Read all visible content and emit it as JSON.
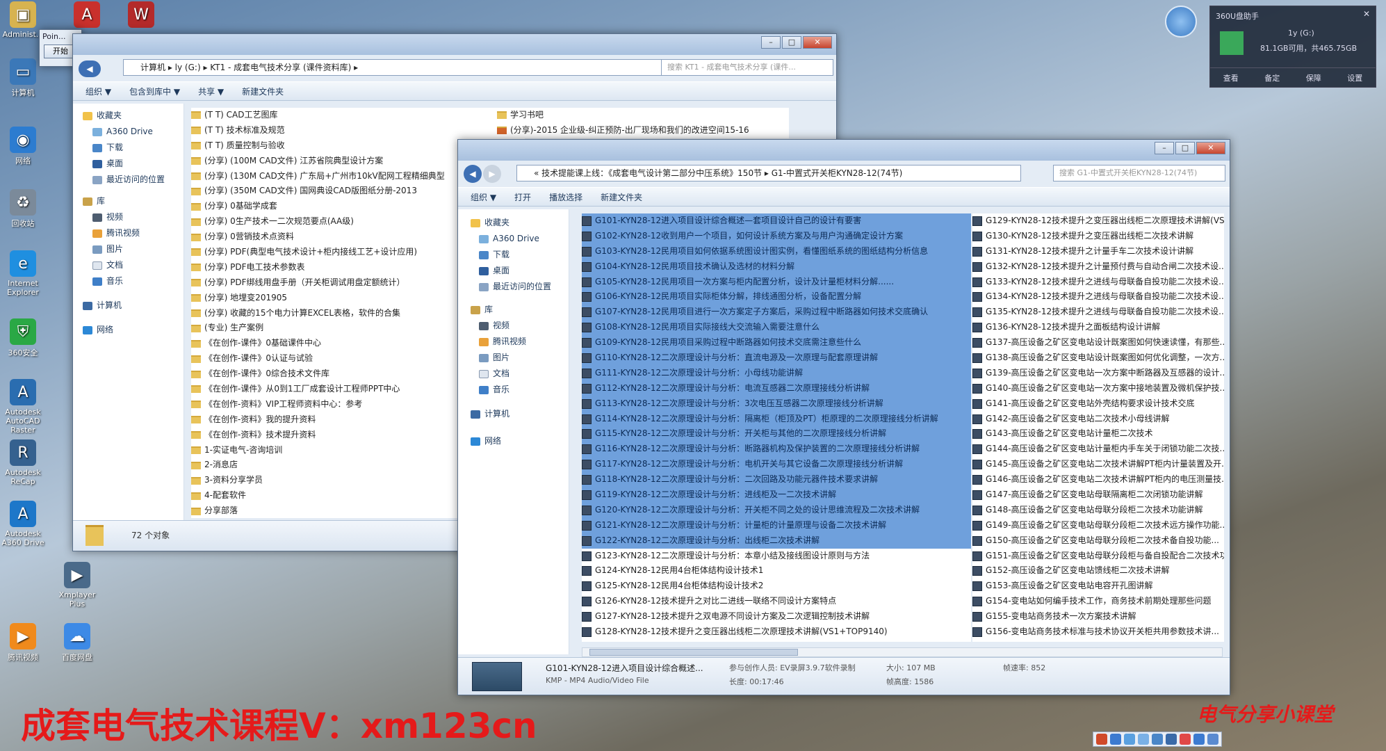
{
  "desktop": {
    "icons": [
      "Administ...",
      "计算机",
      "网络",
      "回收站",
      "Internet Explorer",
      "360安全",
      "Autodesk AutoCAD Raster",
      "Autodesk ReCap",
      "Autodesk A360 Drive",
      "Xmplayer Plus",
      "腾讯视频",
      "百度网盘"
    ]
  },
  "overlay": {
    "watermark": "成套电气技术课程V：xm123cn",
    "brand": "电气分享小课堂"
  },
  "mini_window": {
    "title": "Poin...",
    "button": "开始"
  },
  "left_window": {
    "address": [
      "计算机",
      "ly (G:)",
      "KT1 - 成套电气技术分享 (课件资料库)"
    ],
    "search_placeholder": "搜索 KT1 - 成套电气技术分享 (课件...",
    "toolbar": [
      "组织 ▼",
      "包含到库中 ▼",
      "共享 ▼",
      "新建文件夹"
    ],
    "nav": [
      "收藏夹",
      "A360 Drive",
      "下载",
      "桌面",
      "最近访问的位置",
      "库",
      "视频",
      "腾讯视频",
      "图片",
      "文档",
      "音乐",
      "计算机",
      "网络"
    ],
    "files": [
      "(T T) CAD工艺图库",
      "(T T) 技术标准及规范",
      "(T T) 质量控制与验收",
      "(分享) (100M CAD文件) 江苏省院典型设计方案",
      "(分享) (130M CAD文件) 广东局+广州市10kV配网工程精细典型",
      "(分享) (350M CAD文件) 国网典设CAD版图纸分册-2013",
      "(分享) 0基础学成套",
      "(分享) 0生产技术一二次规范要点(AA级)",
      "(分享) 0营销技术点资料",
      "(分享) PDF(典型电气技术设计+柜内接线工艺+设计应用)",
      "(分享) PDF电工技术参数表",
      "(分享) PDF绑线用盘手册（开关柜调试用盘定额统计）",
      "(分享) 地埋变201905",
      "(分享) 收藏的15个电力计算EXCEL表格，软件的合集",
      "(专业) 生产案例",
      "《在创作-课件》0基础课件中心",
      "《在创作-课件》0认证与试验",
      "《在创作-课件》0综合技术文件库",
      "《在创作-课件》从0到1工厂成套设计工程师PPT中心",
      "《在创作-资料》VIP工程师资料中心：参考",
      "《在创作-资料》我的提升资料",
      "《在创作-资料》技术提升资料",
      "1-实证电气-咨询培训",
      "2-消息店",
      "3-资料分享学员",
      "4-配套软件",
      "分享部落"
    ],
    "files_right": [
      "学习书吧",
      "(分享)-2015 企业级-纠正预防-出厂现场和我们的改进空间15-16"
    ],
    "status": "72 个对象"
  },
  "right_window": {
    "address": [
      "«",
      "技术提能课上线：《成套电气设计第二部分中压系统》150节",
      "G1-中置式开关柜KYN28-12(74节)"
    ],
    "search_placeholder": "搜索 G1-中置式开关柜KYN28-12(74节)",
    "toolbar": [
      "组织 ▼",
      "打开",
      "播放选择",
      "新建文件夹"
    ],
    "nav": [
      "收藏夹",
      "A360 Drive",
      "下载",
      "桌面",
      "最近访问的位置",
      "库",
      "视频",
      "腾讯视频",
      "图片",
      "文档",
      "音乐",
      "计算机",
      "网络"
    ],
    "files_col1": [
      "G101-KYN28-12进入项目设计综合概述—套项目设计自己的设计有要害",
      "G102-KYN28-12收到用户一个项目，如何设计系统方案及与用户沟通确定设计方案",
      "G103-KYN28-12民用项目如何依据系统图设计图实例，看懂图纸系统的图纸结构分析信息",
      "G104-KYN28-12民用项目技术确认及选材的材料分解",
      "G105-KYN28-12民用项目一次方案与柜内配置分析，设计及计量柜材料分解......",
      "G106-KYN28-12民用项目实际柜体分解，排线通图分析，设备配置分解",
      "G107-KYN28-12民用项目进行一次方案定子方案后，采购过程中断路器如何技术交底确认",
      "G108-KYN28-12民用项目实际接线大交流输入需要注意什么",
      "G109-KYN28-12民用项目采购过程中断路器如何技术交底需注意些什么",
      "G110-KYN28-12二次原理设计与分析：直流电源及一次原理与配套原理讲解",
      "G111-KYN28-12二次原理设计与分析：小母线功能讲解",
      "G112-KYN28-12二次原理设计与分析：电流互感器二次原理接线分析讲解",
      "G113-KYN28-12二次原理设计与分析：3次电压互感器二次原理接线分析讲解",
      "G114-KYN28-12二次原理设计与分析：隔离柜（柜顶及PT）柜原理的二次原理接线分析讲解",
      "G115-KYN28-12二次原理设计与分析：开关柜与其他的二次原理接线分析讲解",
      "G116-KYN28-12二次原理设计与分析：断路器机构及保护装置的二次原理接线分析讲解",
      "G117-KYN28-12二次原理设计与分析：电机开关与其它设备二次原理接线分析讲解",
      "G118-KYN28-12二次原理设计与分析：二次回路及功能元器件技术要求讲解",
      "G119-KYN28-12二次原理设计与分析：进线柜及一二次技术讲解",
      "G120-KYN28-12二次原理设计与分析：开关柜不同之处的设计思维流程及二次技术讲解",
      "G121-KYN28-12二次原理设计与分析：计量柜的计量原理与设备二次技术讲解",
      "G122-KYN28-12二次原理设计与分析：出线柜二次技术讲解",
      "G123-KYN28-12二次原理设计与分析：本章小结及接线图设计原则与方法",
      "G124-KYN28-12民用4台柜体结构设计技术1",
      "G125-KYN28-12民用4台柜体结构设计技术2",
      "G126-KYN28-12技术提升之对比二进线一联络不同设计方案特点",
      "G127-KYN28-12技术提升之双电源不同设计方案及二次逻辑控制技术讲解",
      "G128-KYN28-12技术提升之变压器出线柜二次原理技术讲解(VS1+TOP9140)"
    ],
    "files_col2": [
      "G129-KYN28-12技术提升之变压器出线柜二次原理技术讲解(VS1...",
      "G130-KYN28-12技术提升之变压器出线柜二次技术讲解",
      "G131-KYN28-12技术提升之计量手车二次技术设计讲解",
      "G132-KYN28-12技术提升之计量预付费与自动合闸二次技术设...",
      "G133-KYN28-12技术提升之进线与母联备自投功能二次技术设...",
      "G134-KYN28-12技术提升之进线与母联备自投功能二次技术设...",
      "G135-KYN28-12技术提升之进线与母联备自投功能二次技术设...",
      "G136-KYN28-12技术提升之面板结构设计讲解",
      "G137-高压设备之矿区变电站设计既案图如何快速读懂，有那些...",
      "G138-高压设备之矿区变电站设计既案图如何优化调整，一次方...",
      "G139-高压设备之矿区变电站一次方案中断路器及互感器的设计...",
      "G140-高压设备之矿区变电站一次方案中接地装置及微机保护技...",
      "G141-高压设备之矿区变电站外壳结构要求设计技术交底",
      "G142-高压设备之矿区变电站二次技术小母线讲解",
      "G143-高压设备之矿区变电站计量柜二次技术",
      "G144-高压设备之矿区变电站计量柜内手车关于闭锁功能二次技...",
      "G145-高压设备之矿区变电站二次技术讲解PT柜内计量装置及开...",
      "G146-高压设备之矿区变电站二次技术讲解PT柜内的电压测量技...",
      "G147-高压设备之矿区变电站母联隔离柜二次闭锁功能讲解",
      "G148-高压设备之矿区变电站母联分段柜二次技术功能讲解",
      "G149-高压设备之矿区变电站母联分段柜二次技术远方操作功能...",
      "G150-高压设备之矿区变电站母联分段柜二次技术备自投功能...",
      "G151-高压设备之矿区变电站母联分段柜与备自投配合二次技术功...",
      "G152-高压设备之矿区变电站馈线柜二次技术讲解",
      "G153-高压设备之矿区变电站电容开孔图讲解",
      "G154-变电站如何编手技术工作，商务技术前期处理那些问题",
      "G155-变电站商务技术一次方案技术讲解",
      "G156-变电站商务技术标准与技术协议开关柜共用参数技术讲..."
    ],
    "detail": {
      "name": "G101-KYN28-12进入项目设计综合概述...",
      "type": "KMP - MP4 Audio/Video File",
      "author": "参与创作人员: EV录屏3.9.7软件录制",
      "duration": "长度: 00:17:46",
      "size": "大小: 107 MB",
      "height": "帧高度: 1586",
      "rate": "帧速率: 852"
    }
  },
  "widget360": {
    "title": "360U盘助手",
    "drive": "1y (G:)",
    "space": "81.1GB可用，共465.75GB",
    "actions": [
      "查看",
      "备定",
      "保障",
      "设置"
    ]
  }
}
